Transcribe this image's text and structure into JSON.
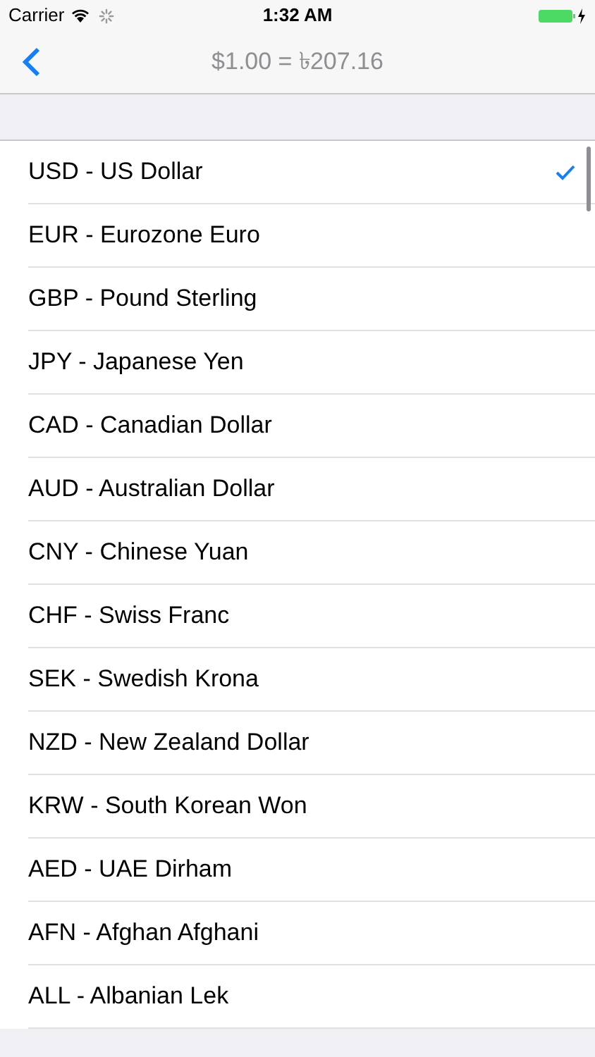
{
  "status_bar": {
    "carrier": "Carrier",
    "time": "1:32 AM"
  },
  "nav_bar": {
    "title": "$1.00 = ৳207.16"
  },
  "currencies": [
    {
      "label": "USD - US Dollar",
      "selected": true
    },
    {
      "label": "EUR - Eurozone Euro",
      "selected": false
    },
    {
      "label": "GBP - Pound Sterling",
      "selected": false
    },
    {
      "label": "JPY - Japanese Yen",
      "selected": false
    },
    {
      "label": "CAD - Canadian Dollar",
      "selected": false
    },
    {
      "label": "AUD - Australian Dollar",
      "selected": false
    },
    {
      "label": "CNY - Chinese Yuan",
      "selected": false
    },
    {
      "label": "CHF - Swiss Franc",
      "selected": false
    },
    {
      "label": "SEK - Swedish Krona",
      "selected": false
    },
    {
      "label": "NZD - New Zealand Dollar",
      "selected": false
    },
    {
      "label": "KRW - South Korean Won",
      "selected": false
    },
    {
      "label": "AED - UAE Dirham",
      "selected": false
    },
    {
      "label": "AFN - Afghan Afghani",
      "selected": false
    },
    {
      "label": "ALL - Albanian Lek",
      "selected": false
    }
  ]
}
